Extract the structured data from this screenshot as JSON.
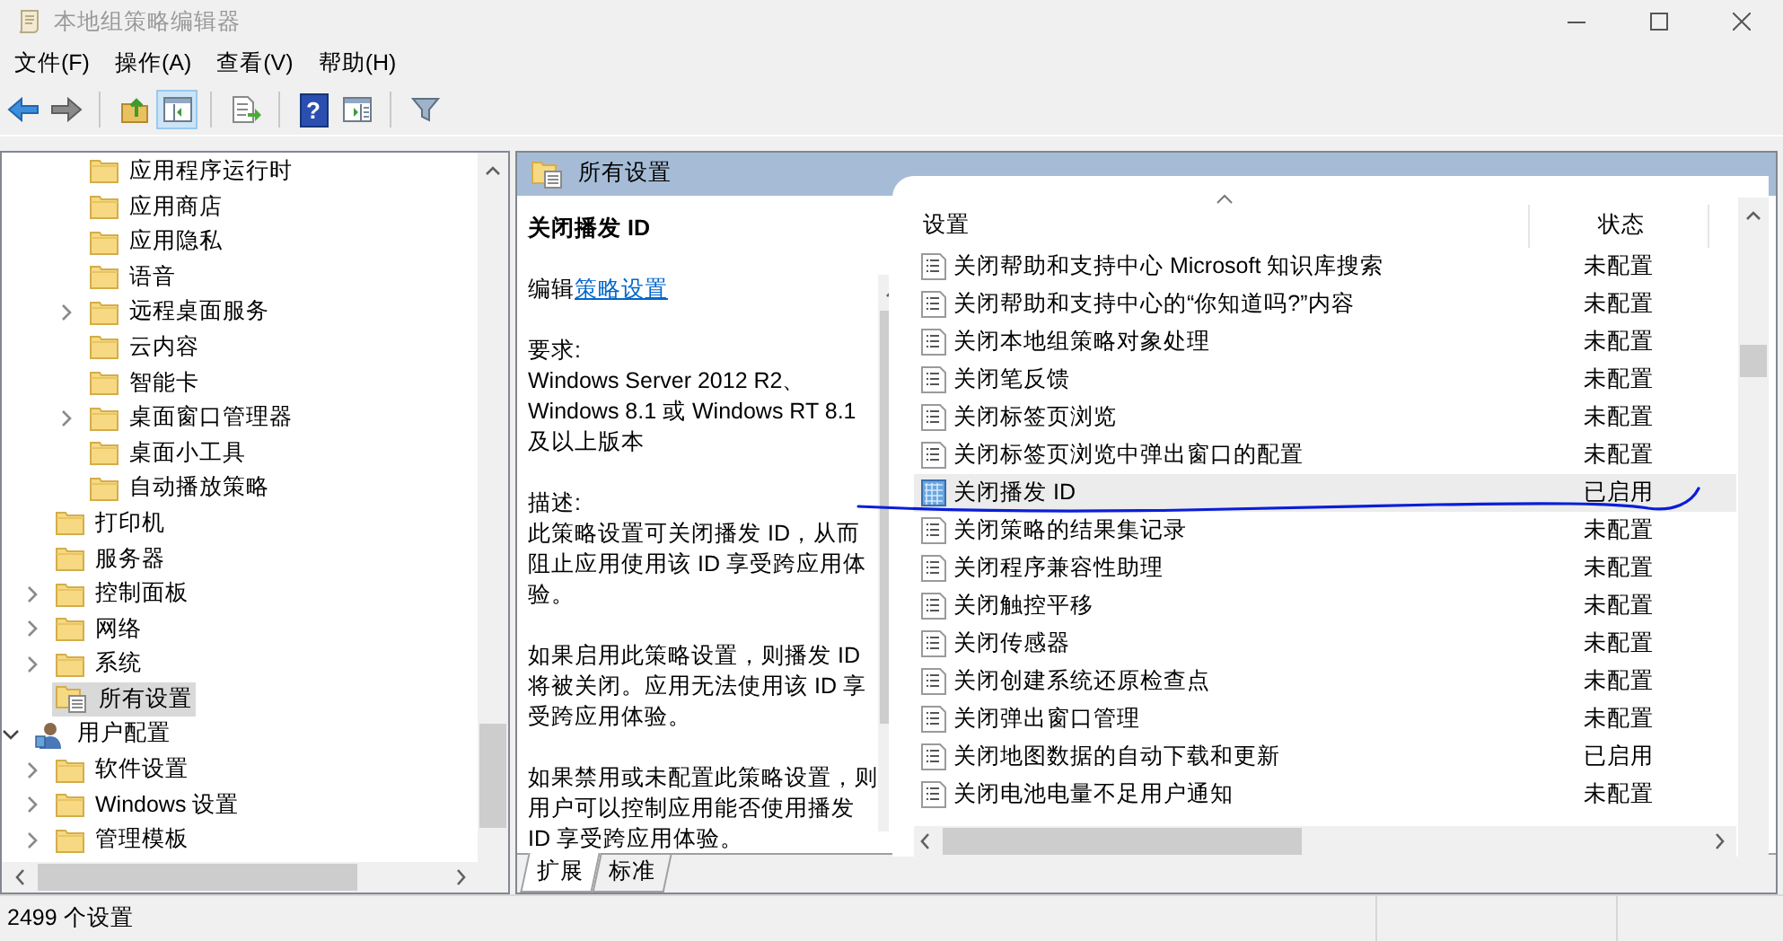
{
  "window": {
    "title": "本地组策略编辑器"
  },
  "menu": [
    "文件(F)",
    "操作(A)",
    "查看(V)",
    "帮助(H)"
  ],
  "toolbar": [
    {
      "kind": "back",
      "pressed": false
    },
    {
      "kind": "forward",
      "pressed": false
    },
    {
      "kind": "separator"
    },
    {
      "kind": "up",
      "pressed": false
    },
    {
      "kind": "tree",
      "pressed": true
    },
    {
      "kind": "separator"
    },
    {
      "kind": "export",
      "pressed": false
    },
    {
      "kind": "separator"
    },
    {
      "kind": "help",
      "pressed": false,
      "glyph": "?"
    },
    {
      "kind": "pane",
      "pressed": false
    },
    {
      "kind": "separator"
    },
    {
      "kind": "filter",
      "pressed": false
    }
  ],
  "tree": {
    "items": [
      {
        "children": [
          {
            "children": [
              {
                "label": "应用程序运行时",
                "kind": "folder",
                "selected": false
              },
              {
                "label": "应用商店",
                "kind": "folder",
                "selected": false
              },
              {
                "label": "应用隐私",
                "kind": "folder",
                "selected": false
              },
              {
                "label": "语音",
                "kind": "folder",
                "selected": false
              },
              {
                "label": "远程桌面服务",
                "kind": "folder",
                "selected": false,
                "expanded": false
              },
              {
                "label": "云内容",
                "kind": "folder",
                "selected": false
              },
              {
                "label": "智能卡",
                "kind": "folder",
                "selected": false
              },
              {
                "label": "桌面窗口管理器",
                "kind": "folder",
                "selected": false,
                "expanded": false
              },
              {
                "label": "桌面小工具",
                "kind": "folder",
                "selected": false
              },
              {
                "label": "自动播放策略",
                "kind": "folder",
                "selected": false
              }
            ]
          },
          {
            "label": "打印机",
            "kind": "folder",
            "selected": false
          },
          {
            "label": "服务器",
            "kind": "folder",
            "selected": false
          },
          {
            "label": "控制面板",
            "kind": "folder",
            "selected": false,
            "expanded": false
          },
          {
            "label": "网络",
            "kind": "folder",
            "selected": false,
            "expanded": false
          },
          {
            "label": "系统",
            "kind": "folder",
            "selected": false,
            "expanded": false
          },
          {
            "label": "所有设置",
            "kind": "settings",
            "selected": true
          }
        ]
      },
      {
        "label": "用户配置",
        "kind": "user",
        "selected": false,
        "expanded": true,
        "children": [
          {
            "label": "软件设置",
            "kind": "folder",
            "selected": false,
            "expanded": false
          },
          {
            "label": "Windows 设置",
            "kind": "folder",
            "selected": false,
            "expanded": false
          },
          {
            "label": "管理模板",
            "kind": "folder",
            "selected": false,
            "expanded": false
          }
        ]
      }
    ]
  },
  "panel": {
    "title": "所有设置"
  },
  "details": {
    "title": "关闭播发 ID",
    "edit_prefix": "编辑",
    "edit_link": "策略设置",
    "requirements_label": "要求:",
    "requirements": "Windows Server 2012 R2、Windows 8.1 或 Windows RT 8.1 及以上版本",
    "description_label": "描述:",
    "description": [
      "此策略设置可关闭播发 ID，从而阻止应用使用该 ID 享受跨应用体验。",
      "如果启用此策略设置，则播发 ID 将被关闭。应用无法使用该 ID 享受跨应用体验。",
      "如果禁用或未配置此策略设置，则用户可以控制应用能否使用播发 ID 享受跨应用体验。"
    ]
  },
  "view_tabs": [
    {
      "label": "扩展",
      "selected": true
    },
    {
      "label": "标准",
      "selected": false
    }
  ],
  "list": {
    "columns": [
      "设置",
      "状态"
    ],
    "rows": [
      {
        "name": "关闭帮助和支持中心 Microsoft 知识库搜索",
        "state": "未配置",
        "selected": false
      },
      {
        "name": "关闭帮助和支持中心的“你知道吗?”内容",
        "state": "未配置",
        "selected": false
      },
      {
        "name": "关闭本地组策略对象处理",
        "state": "未配置",
        "selected": false
      },
      {
        "name": "关闭笔反馈",
        "state": "未配置",
        "selected": false
      },
      {
        "name": "关闭标签页浏览",
        "state": "未配置",
        "selected": false
      },
      {
        "name": "关闭标签页浏览中弹出窗口的配置",
        "state": "未配置",
        "selected": false
      },
      {
        "name": "关闭播发 ID",
        "state": "已启用",
        "selected": true
      },
      {
        "name": "关闭策略的结果集记录",
        "state": "未配置",
        "selected": false
      },
      {
        "name": "关闭程序兼容性助理",
        "state": "未配置",
        "selected": false
      },
      {
        "name": "关闭触控平移",
        "state": "未配置",
        "selected": false
      },
      {
        "name": "关闭传感器",
        "state": "未配置",
        "selected": false
      },
      {
        "name": "关闭创建系统还原检查点",
        "state": "未配置",
        "selected": false
      },
      {
        "name": "关闭弹出窗口管理",
        "state": "未配置",
        "selected": false
      },
      {
        "name": "关闭地图数据的自动下载和更新",
        "state": "已启用",
        "selected": false
      },
      {
        "name": "关闭电池电量不足用户通知",
        "state": "未配置",
        "selected": false
      }
    ]
  },
  "status_bar": "2499 个设置"
}
